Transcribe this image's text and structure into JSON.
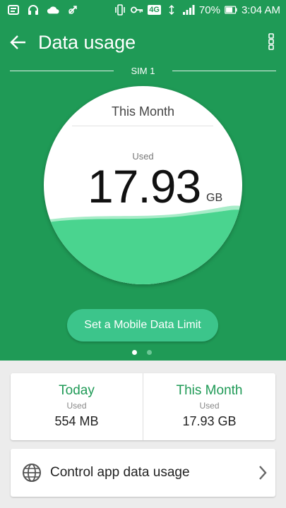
{
  "status_bar": {
    "battery": "70%",
    "time": "3:04 AM",
    "network_type": "4G",
    "left_icons": [
      "notification-icon",
      "headset-icon",
      "cloud-icon",
      "signal-off-icon"
    ],
    "right_icons": [
      "vibrate-icon",
      "key-icon",
      "wifi-signal-icon",
      "cell-signal-icon",
      "battery-icon"
    ]
  },
  "app_bar": {
    "title": "Data usage"
  },
  "sim": {
    "label": "SIM 1"
  },
  "dial": {
    "period": "This Month",
    "used_label": "Used",
    "value": "17.93",
    "unit": "GB"
  },
  "limit_button": {
    "label": "Set a Mobile Data Limit"
  },
  "pager": {
    "count": 2,
    "active": 0
  },
  "summary": {
    "today": {
      "label": "Today",
      "sub": "Used",
      "value": "554 MB"
    },
    "month": {
      "label": "This Month",
      "sub": "Used",
      "value": "17.93 GB"
    }
  },
  "control": {
    "label": "Control app data usage"
  },
  "colors": {
    "primary": "#1f9a56",
    "button": "#3cc58b",
    "wave": "#4ad48f"
  }
}
